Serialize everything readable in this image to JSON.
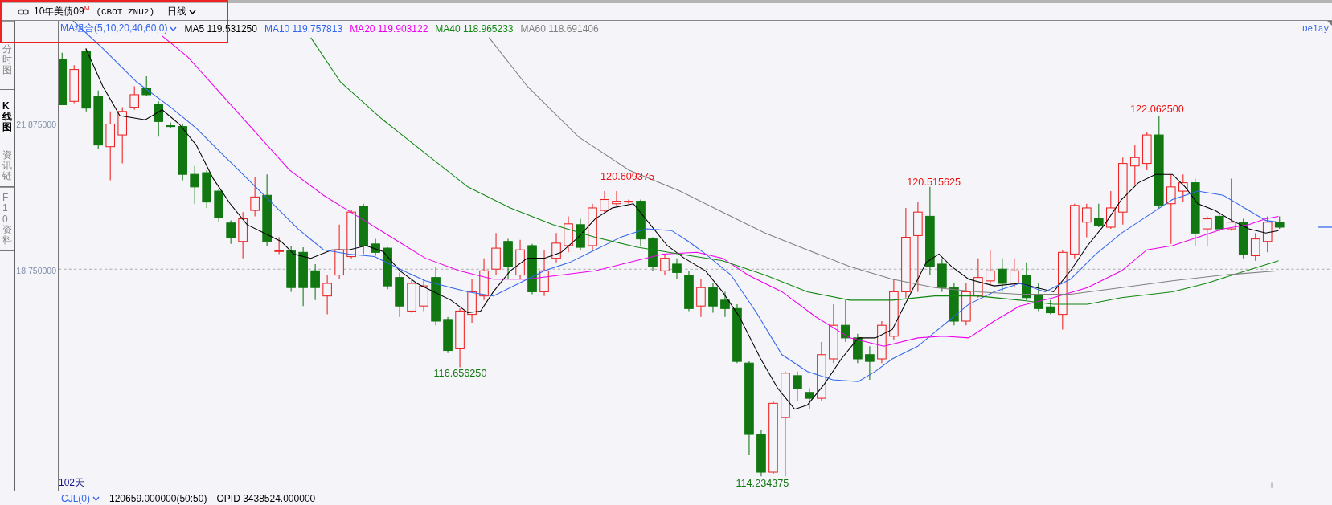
{
  "header": {
    "title": "10年美债09",
    "title_mark": "M",
    "code": "(CBOT ZNU2)",
    "period": "日线"
  },
  "side_tabs": [
    {
      "label": "分时图",
      "selected": false
    },
    {
      "label": "K线图",
      "selected": true
    },
    {
      "label": "资讯链",
      "selected": false
    },
    {
      "label": "F10资料",
      "selected": false
    }
  ],
  "indicators": {
    "group": "MA组合(5,10,20,40,60,0)",
    "items": [
      {
        "label": "MA5 119.531250",
        "color": "#000000"
      },
      {
        "label": "MA10 119.757813",
        "color": "#3366ee"
      },
      {
        "label": "MA20 119.903122",
        "color": "#ee00ee"
      },
      {
        "label": "MA40 118.965233",
        "color": "#118811"
      },
      {
        "label": "MA60 118.691406",
        "color": "#808080"
      }
    ]
  },
  "delay": "Delay",
  "price_axis": [
    {
      "label": "21.875000"
    },
    {
      "label": "18.750000"
    }
  ],
  "annotations": [
    {
      "text": "120.609375",
      "kind": "high"
    },
    {
      "text": "116.656250",
      "kind": "low"
    },
    {
      "text": "114.234375",
      "kind": "low"
    },
    {
      "text": "120.515625",
      "kind": "high"
    },
    {
      "text": "122.062500",
      "kind": "high"
    }
  ],
  "day_count": "102天",
  "volume_bar": {
    "indicator": "CJL(0)",
    "value": "120659.000000(50:50)",
    "opid": "OPID 3438524.000000"
  }
}
